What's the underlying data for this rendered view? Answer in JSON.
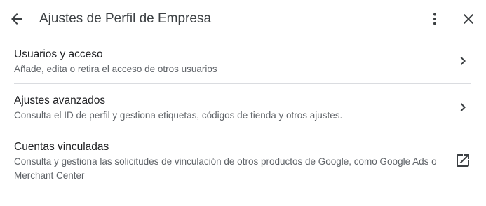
{
  "header": {
    "back_icon": "arrow-back-icon",
    "title": "Ajustes de Perfil de Empresa",
    "more_icon": "more-vert-icon",
    "close_icon": "close-icon"
  },
  "items": [
    {
      "title": "Usuarios y acceso",
      "description": "Añade, edita o retira el acceso de otros usuarios",
      "trailing_icon": "chevron-right-icon"
    },
    {
      "title": "Ajustes avanzados",
      "description": "Consulta el ID de perfil y gestiona etiquetas, códigos de tienda y otros ajustes.",
      "trailing_icon": "chevron-right-icon"
    },
    {
      "title": "Cuentas vinculadas",
      "description": "Consulta y gestiona las solicitudes de vinculación de otros productos de Google, como Google Ads o Merchant Center",
      "trailing_icon": "open-in-new-icon"
    }
  ],
  "colors": {
    "text_primary": "#202124",
    "text_secondary": "#5f6368",
    "icon": "#3c4043",
    "divider": "#dadce0"
  }
}
